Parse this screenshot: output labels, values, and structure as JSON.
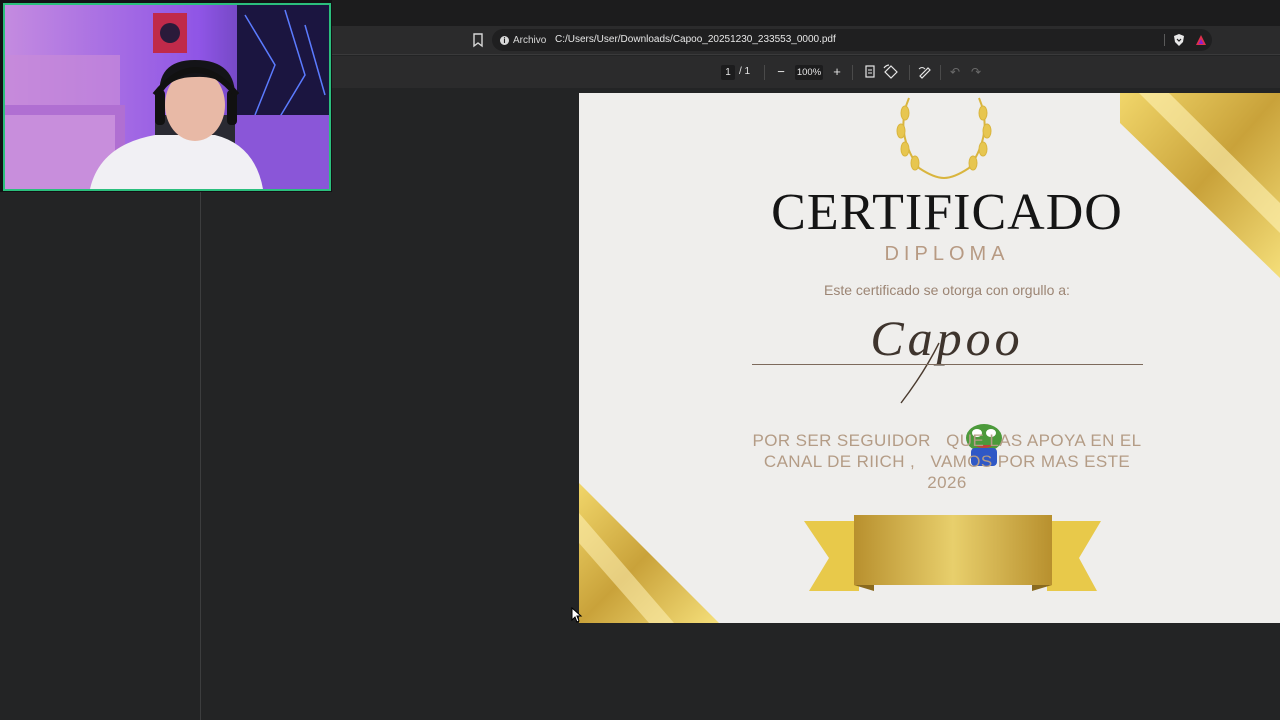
{
  "browser": {
    "origin_label": "Archivo",
    "url": "C:/Users/User/Downloads/Capoo_20251230_233553_0000.pdf"
  },
  "pdf_toolbar": {
    "current_page": "1",
    "total_pages": "/  1",
    "zoom": "100%"
  },
  "certificate": {
    "title": "CERTIFICADO",
    "subtitle": "DIPLOMA",
    "given_text": "Este certificado se otorga con orgullo a:",
    "recipient": "Capoo",
    "reason_line1": "POR SER SEGUIDOR   QUE LAS APOYA EN EL",
    "reason_line2": "CANAL DE RIICH ,   VAMOS POR MAS ESTE",
    "reason_line3": "2026"
  },
  "colors": {
    "gold": "#d8b642",
    "gold_dark": "#b48f2a",
    "accent_green": "#2bbf7d",
    "page_bg": "#efeeec"
  },
  "icons": [
    "bookmark-icon",
    "info-icon",
    "brave-shield-icon",
    "brave-rewards-icon",
    "zoom-out-icon",
    "zoom-in-icon",
    "fit-page-icon",
    "rotate-icon",
    "draw-icon",
    "undo-icon",
    "redo-icon",
    "laurel-wreath-icon",
    "frog-sticker-icon",
    "cursor-icon"
  ]
}
